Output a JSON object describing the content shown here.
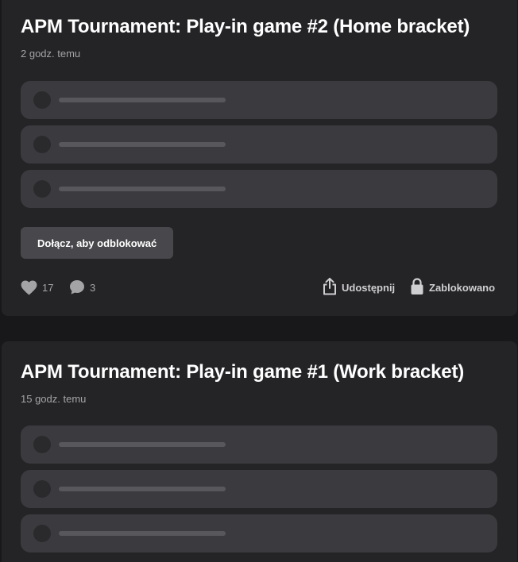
{
  "posts": [
    {
      "title": "APM Tournament: Play-in game #2 (Home bracket)",
      "time": "2 godz. temu",
      "join_label": "Dołącz, aby odblokować",
      "likes": "17",
      "comments": "3",
      "share_label": "Udostępnij",
      "locked_label": "Zablokowano"
    },
    {
      "title": "APM Tournament: Play-in game #1 (Work bracket)",
      "time": "15 godz. temu"
    }
  ],
  "colors": {
    "background": "#18171a",
    "card": "#242326",
    "option": "#3b3a3e",
    "button": "#48474b",
    "muted_text": "#a4a3a6"
  },
  "icons": {
    "likes": "heart-icon",
    "comments": "comment-bubble-icon",
    "share": "share-icon",
    "locked": "lock-icon"
  }
}
